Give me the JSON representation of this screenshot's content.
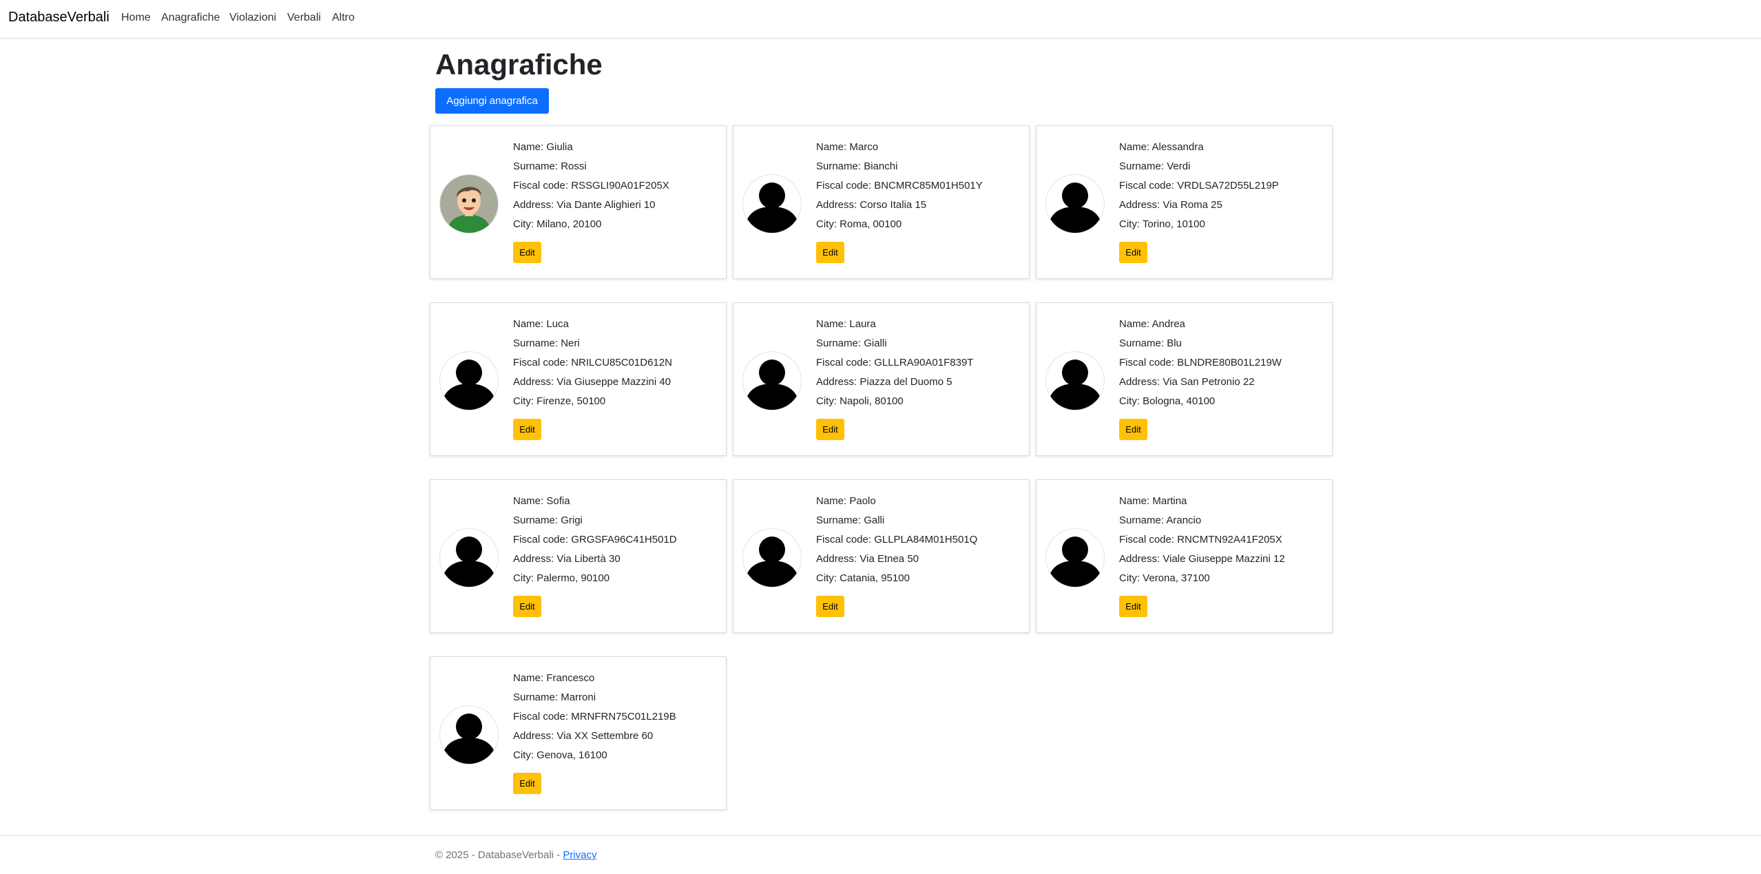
{
  "navbar": {
    "brand": "DatabaseVerbali",
    "links": [
      "Home",
      "Anagrafiche",
      "Violazioni",
      "Verbali",
      "Altro"
    ]
  },
  "page": {
    "title": "Anagrafiche",
    "add_button": "Aggiungi anagrafica"
  },
  "labels": {
    "name": "Name: ",
    "surname": "Surname: ",
    "fiscal_code": "Fiscal code: ",
    "address": "Address: ",
    "city": "City: ",
    "edit": "Edit"
  },
  "people": [
    {
      "name": "Giulia",
      "surname": "Rossi",
      "fiscal_code": "RSSGLI90A01F205X",
      "address": "Via Dante Alighieri 10",
      "city": "Milano, 20100",
      "avatar": "cartoon-person-avatar"
    },
    {
      "name": "Marco",
      "surname": "Bianchi",
      "fiscal_code": "BNCMRC85M01H501Y",
      "address": "Corso Italia 15",
      "city": "Roma, 00100",
      "avatar": "person-silhouette-icon"
    },
    {
      "name": "Alessandra",
      "surname": "Verdi",
      "fiscal_code": "VRDLSA72D55L219P",
      "address": "Via Roma 25",
      "city": "Torino, 10100",
      "avatar": "person-silhouette-icon"
    },
    {
      "name": "Luca",
      "surname": "Neri",
      "fiscal_code": "NRILCU85C01D612N",
      "address": "Via Giuseppe Mazzini 40",
      "city": "Firenze, 50100",
      "avatar": "person-silhouette-icon"
    },
    {
      "name": "Laura",
      "surname": "Gialli",
      "fiscal_code": "GLLLRA90A01F839T",
      "address": "Piazza del Duomo 5",
      "city": "Napoli, 80100",
      "avatar": "person-silhouette-icon"
    },
    {
      "name": "Andrea",
      "surname": "Blu",
      "fiscal_code": "BLNDRE80B01L219W",
      "address": "Via San Petronio 22",
      "city": "Bologna, 40100",
      "avatar": "person-silhouette-icon"
    },
    {
      "name": "Sofia",
      "surname": "Grigi",
      "fiscal_code": "GRGSFA96C41H501D",
      "address": "Via Libertà 30",
      "city": "Palermo, 90100",
      "avatar": "person-silhouette-icon"
    },
    {
      "name": "Paolo",
      "surname": "Galli",
      "fiscal_code": "GLLPLA84M01H501Q",
      "address": "Via Etnea 50",
      "city": "Catania, 95100",
      "avatar": "person-silhouette-icon"
    },
    {
      "name": "Martina",
      "surname": "Arancio",
      "fiscal_code": "RNCMTN92A41F205X",
      "address": "Viale Giuseppe Mazzini 12",
      "city": "Verona, 37100",
      "avatar": "person-silhouette-icon"
    },
    {
      "name": "Francesco",
      "surname": "Marroni",
      "fiscal_code": "MRNFRN75C01L219B",
      "address": "Via XX Settembre 60",
      "city": "Genova, 16100",
      "avatar": "person-silhouette-icon"
    }
  ],
  "footer": {
    "copyright": "© 2025 - DatabaseVerbali - ",
    "privacy": "Privacy"
  },
  "colors": {
    "primary": "#0d6efd",
    "warning": "#ffc107"
  }
}
